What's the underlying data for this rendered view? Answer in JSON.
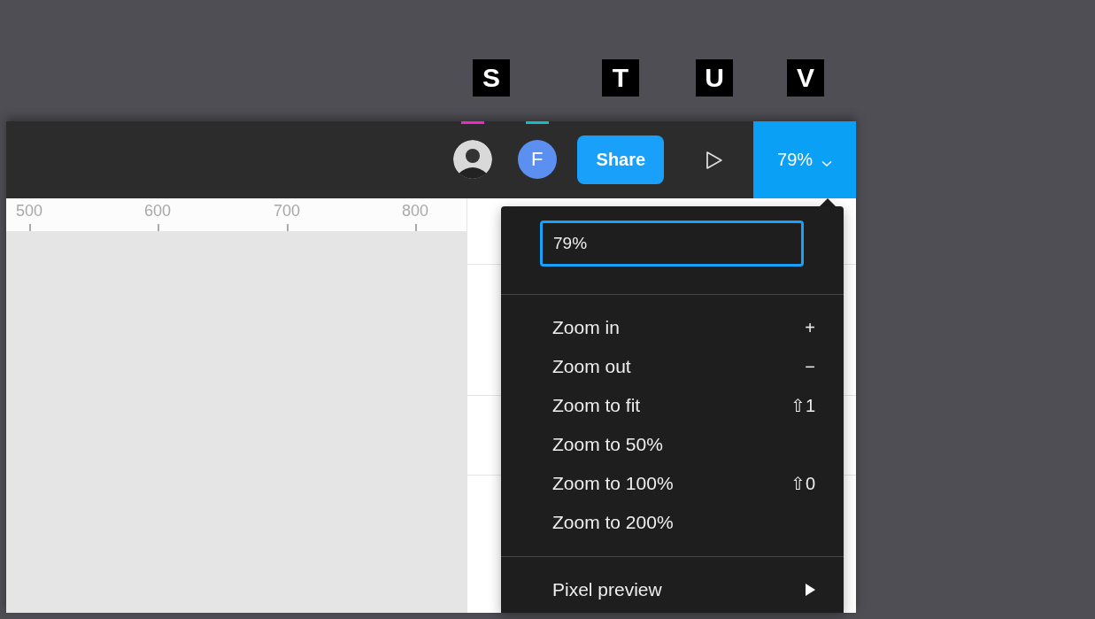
{
  "annotations": [
    {
      "label": "S"
    },
    {
      "label": "T"
    },
    {
      "label": "U"
    },
    {
      "label": "V"
    }
  ],
  "toolbar": {
    "collaborators": [
      {
        "kind": "photo",
        "color": "#f027c8"
      },
      {
        "kind": "initial",
        "initial": "F",
        "color": "#19b9c4"
      }
    ],
    "share_button": "Share",
    "zoom_button": {
      "label": "79%",
      "expanded": true
    }
  },
  "ruler": {
    "ticks": [
      "500",
      "600",
      "700",
      "800"
    ]
  },
  "zoom_menu": {
    "input": {
      "value": "79%"
    },
    "sections": [
      {
        "items": [
          {
            "kind": "action",
            "label": "Zoom in",
            "shortcut": "+"
          },
          {
            "kind": "action",
            "label": "Zoom out",
            "shortcut": "−"
          },
          {
            "kind": "action",
            "label": "Zoom to fit",
            "shortcut": "⇧1"
          },
          {
            "kind": "action",
            "label": "Zoom to 50%"
          },
          {
            "kind": "action",
            "label": "Zoom to 100%",
            "shortcut": "⇧0"
          },
          {
            "kind": "action",
            "label": "Zoom to 200%"
          }
        ]
      },
      {
        "items": [
          {
            "kind": "submenu",
            "label": "Pixel preview"
          }
        ]
      }
    ]
  }
}
